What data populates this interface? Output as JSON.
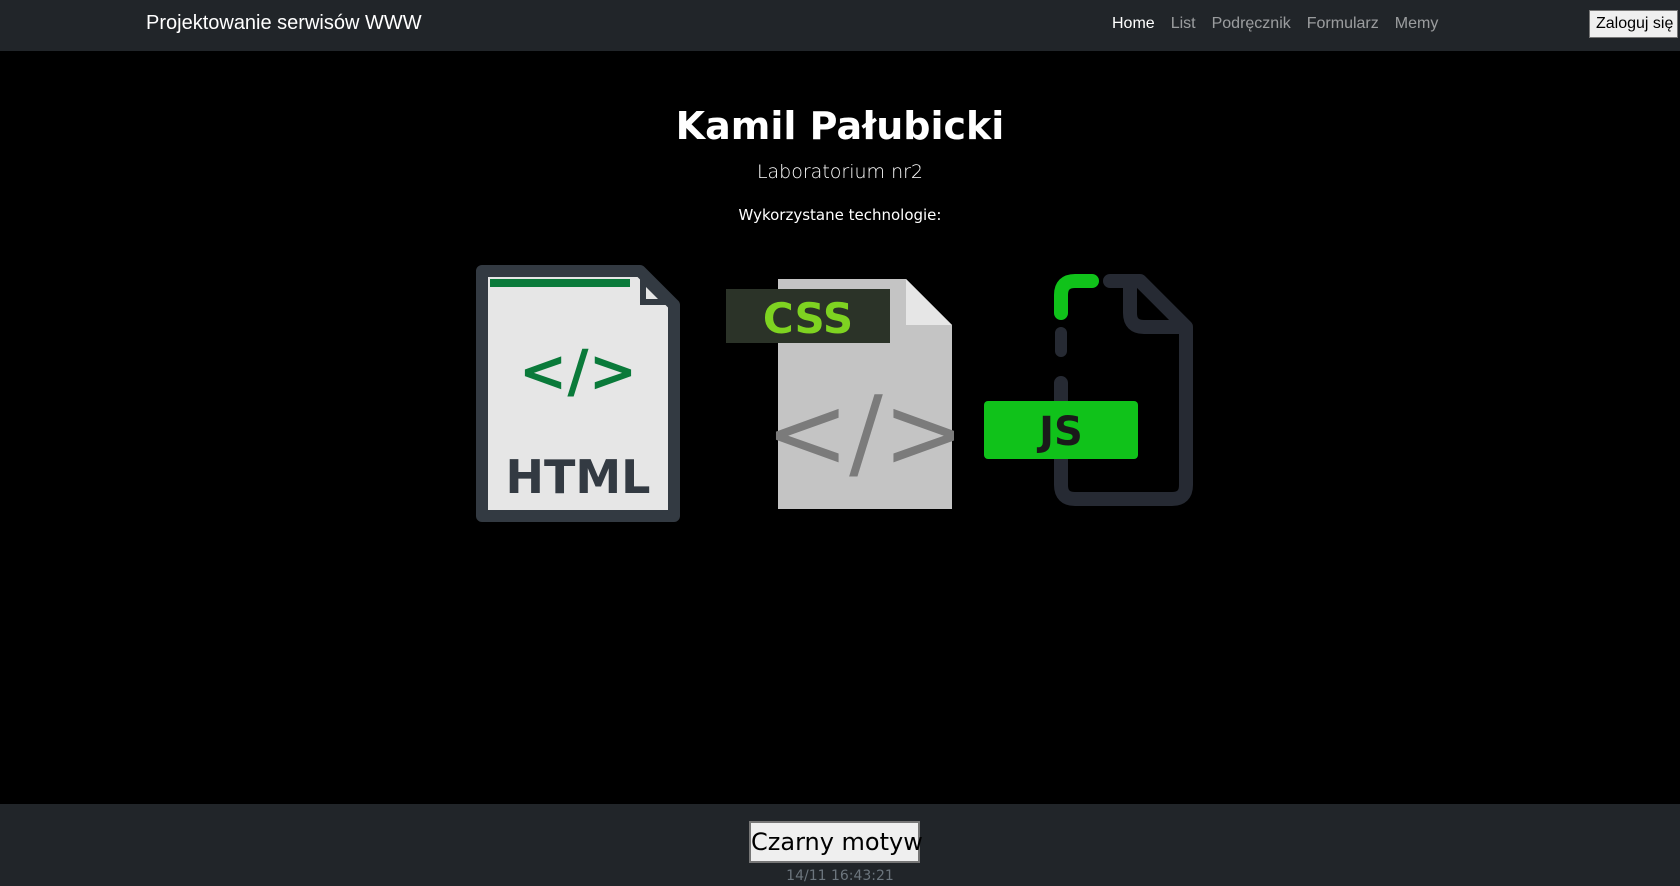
{
  "navbar": {
    "brand": "Projektowanie serwisów WWW",
    "links": [
      {
        "label": "Home",
        "active": true
      },
      {
        "label": "List",
        "active": false
      },
      {
        "label": "Podręcznik",
        "active": false
      },
      {
        "label": "Formularz",
        "active": false
      },
      {
        "label": "Memy",
        "active": false
      }
    ],
    "login_label": "Zaloguj się"
  },
  "main": {
    "title": "Kamil Pałubicki",
    "subtitle": "Laboratorium nr2",
    "technologies_label": "Wykorzystane technologie:",
    "logos": [
      {
        "name": "html-file-icon",
        "text": "HTML",
        "code": "</>"
      },
      {
        "name": "css-file-icon",
        "text": "CSS",
        "code": "</>"
      },
      {
        "name": "js-file-icon",
        "text": "JS"
      }
    ]
  },
  "footer": {
    "theme_button_label": "Czarny motyw",
    "clock": "14/11 16:43:21"
  },
  "colors": {
    "navbar_bg": "#212529",
    "html_green": "#0a7a3a",
    "css_green": "#7ed321",
    "js_green": "#10c21a"
  }
}
